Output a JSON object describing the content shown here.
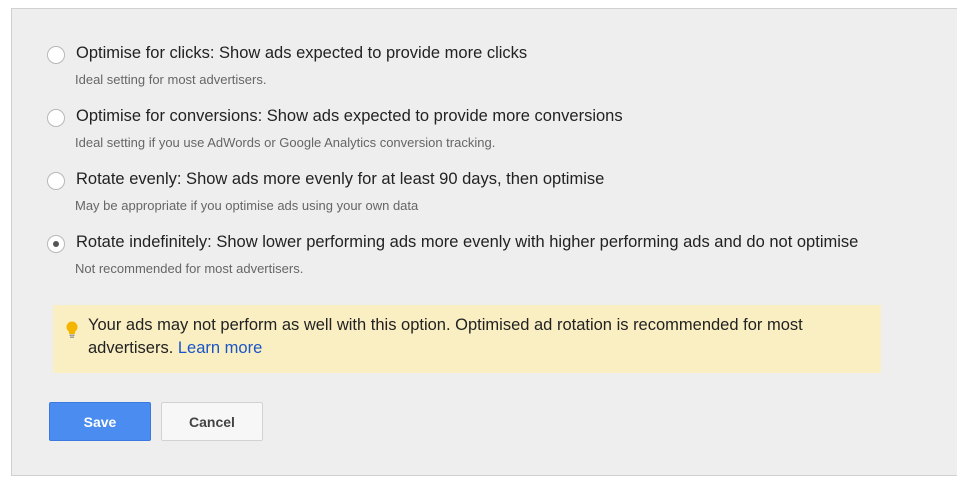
{
  "options": [
    {
      "label": "Optimise for clicks: Show ads expected to provide more clicks",
      "description": "Ideal setting for most advertisers.",
      "selected": false
    },
    {
      "label": "Optimise for conversions: Show ads expected to provide more conversions",
      "description": "Ideal setting if you use AdWords or Google Analytics conversion tracking.",
      "selected": false
    },
    {
      "label": "Rotate evenly: Show ads more evenly for at least 90 days, then optimise",
      "description": "May be appropriate if you optimise ads using your own data",
      "selected": false
    },
    {
      "label": "Rotate indefinitely: Show lower performing ads more evenly with higher performing ads and do not optimise",
      "description": "Not recommended for most advertisers.",
      "selected": true
    }
  ],
  "warning": {
    "icon": "lightbulb-icon",
    "message": "Your ads may not perform as well with this option. Optimised ad rotation is recommended for most advertisers.",
    "link_label": "Learn more"
  },
  "buttons": {
    "save_label": "Save",
    "cancel_label": "Cancel"
  },
  "colors": {
    "panel_background": "#eeeeee",
    "warning_background": "#faefc2",
    "warning_icon": "#f4b400",
    "link": "#1a55c7",
    "primary_button": "#4a8cf0"
  }
}
